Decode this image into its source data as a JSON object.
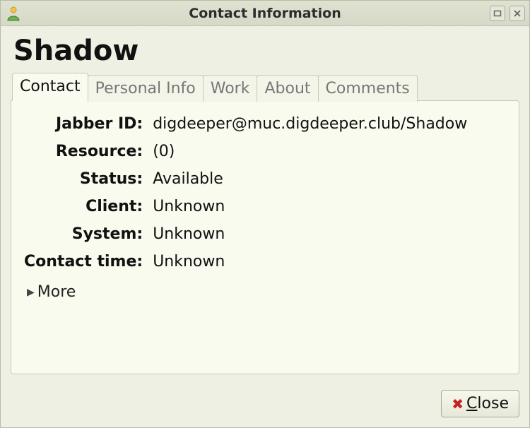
{
  "window": {
    "title": "Contact Information"
  },
  "contact": {
    "name": "Shadow"
  },
  "tabs": {
    "contact": "Contact",
    "personal_info": "Personal Info",
    "work": "Work",
    "about": "About",
    "comments": "Comments"
  },
  "fields": {
    "jabber_id": {
      "label": "Jabber ID:",
      "value": "digdeeper@muc.digdeeper.club/Shadow"
    },
    "resource": {
      "label": "Resource:",
      "value": " (0)"
    },
    "status": {
      "label": "Status:",
      "value": "Available"
    },
    "client": {
      "label": "Client:",
      "value": "Unknown"
    },
    "system": {
      "label": "System:",
      "value": "Unknown"
    },
    "contact_time": {
      "label": "Contact time:",
      "value": "Unknown"
    }
  },
  "expander": {
    "more_label": "More"
  },
  "buttons": {
    "close": "Close"
  }
}
